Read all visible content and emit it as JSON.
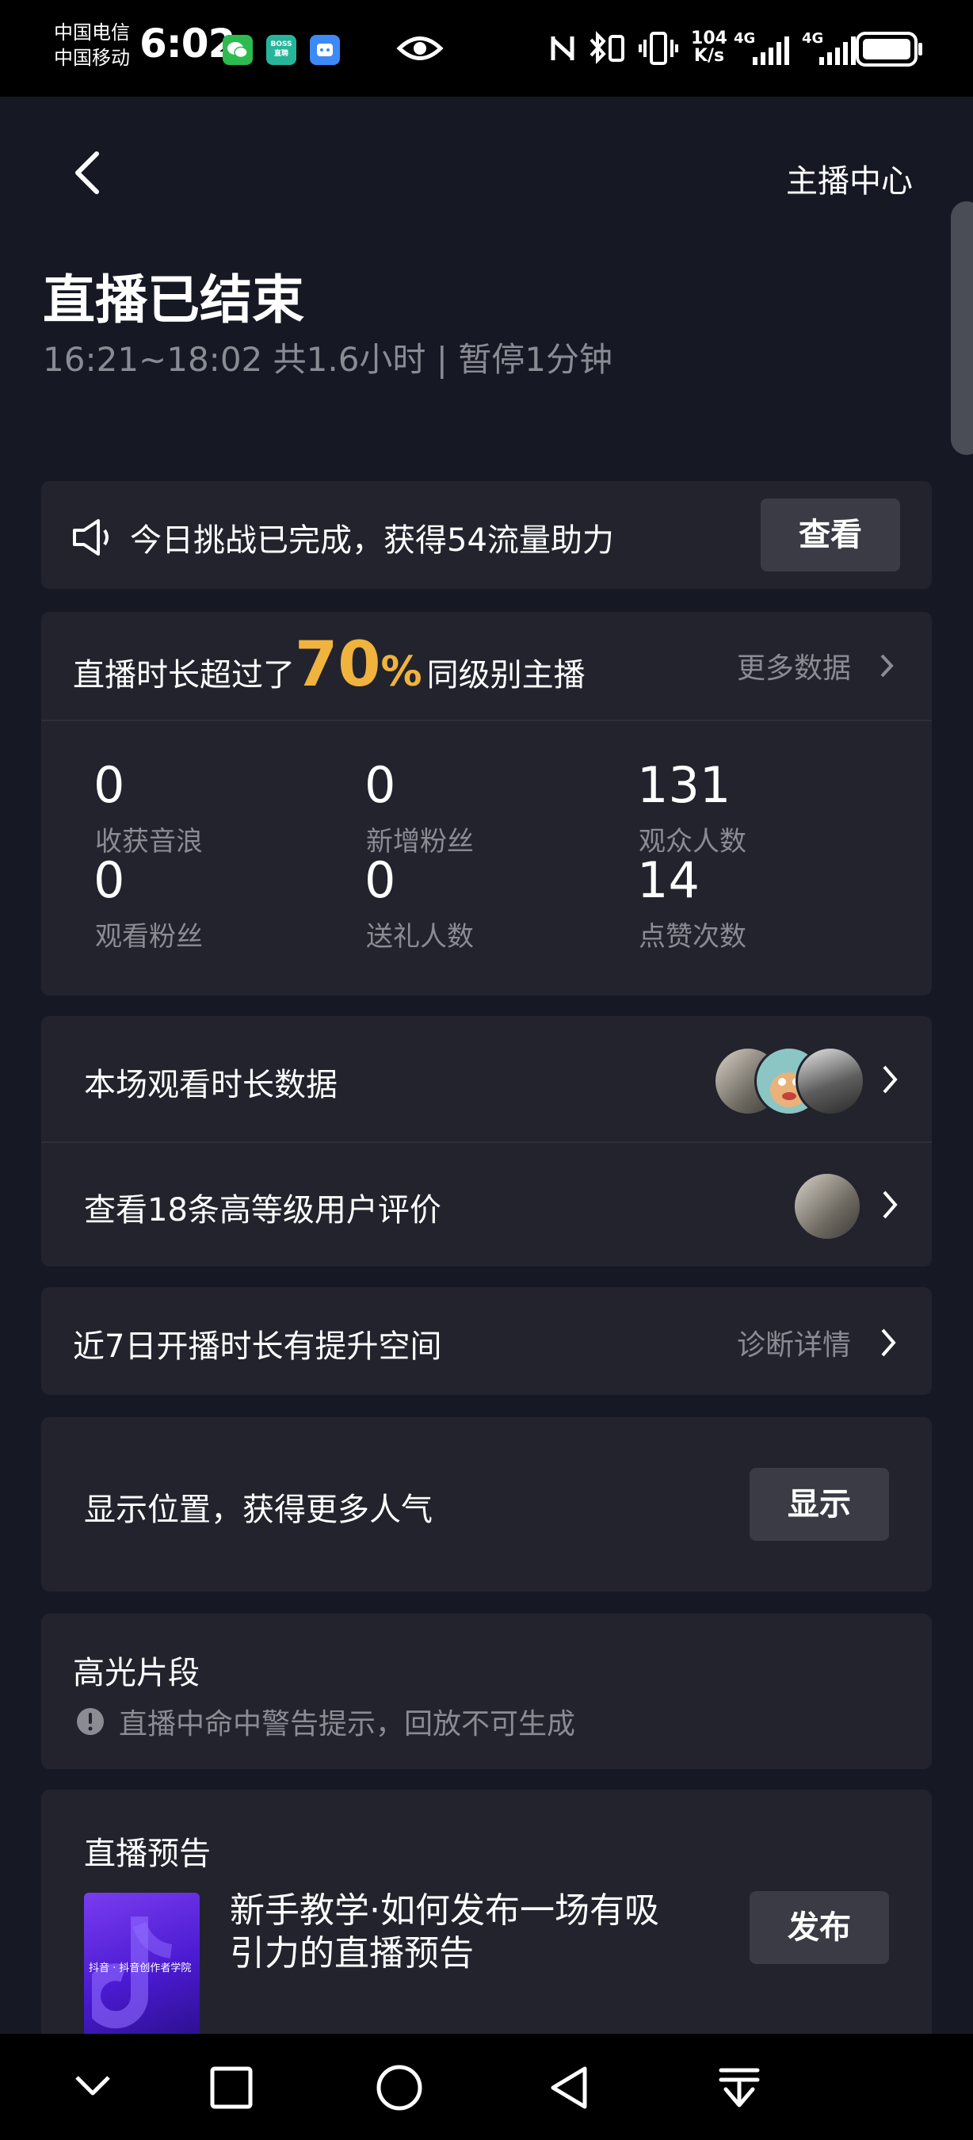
{
  "status_bar": {
    "carrier1": "中国电信",
    "carrier2": "中国移动",
    "time": "6:02",
    "app_boss_line1": "BOSS",
    "app_boss_line2": "直聘",
    "net_speed_top": "104",
    "net_speed_bottom": "K/s",
    "net1": "4G",
    "net2": "4G"
  },
  "header": {
    "center_link": "主播中心"
  },
  "summary": {
    "title": "直播已结束",
    "subtitle": "16:21~18:02 共1.6小时 | 暂停1分钟"
  },
  "challenge": {
    "text": "今日挑战已完成，获得54流量助力",
    "button": "查看"
  },
  "stats_card": {
    "prefix": "直播时长超过了",
    "percent": "70",
    "percent_sign": "%",
    "suffix": "同级别主播",
    "more_link": "更多数据",
    "stats": [
      {
        "value": "0",
        "label": "收获音浪"
      },
      {
        "value": "0",
        "label": "新增粉丝"
      },
      {
        "value": "131",
        "label": "观众人数"
      },
      {
        "value": "0",
        "label": "观看粉丝"
      },
      {
        "value": "0",
        "label": "送礼人数"
      },
      {
        "value": "14",
        "label": "点赞次数"
      }
    ]
  },
  "watch_duration": {
    "label": "本场观看时长数据"
  },
  "reviews": {
    "label": "查看18条高等级用户评价"
  },
  "improve": {
    "label": "近7日开播时长有提升空间",
    "link": "诊断详情"
  },
  "location": {
    "label": "显示位置，获得更多人气",
    "button": "显示"
  },
  "highlights": {
    "title": "高光片段",
    "warning": "直播中命中警告提示，回放不可生成"
  },
  "preview": {
    "title": "直播预告",
    "item_line1": "新手教学·如何发布一场有吸",
    "item_line2": "引力的直播预告",
    "thumb_caption": "抖音 · 抖音创作者学院",
    "button": "发布"
  },
  "colors": {
    "background": "#161823",
    "card": "#22232d",
    "accent_percent": "#f0b33e",
    "muted_text": "#8a8b93"
  }
}
